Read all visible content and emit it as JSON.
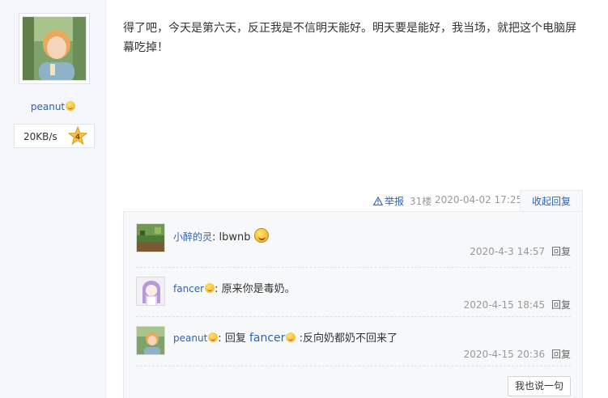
{
  "post": {
    "text": "得了吧，今天是第六天，反正我是不信明天能好。明天要是能好，我当场，就把这个电脑屏幕吃掉！",
    "report_label": "举报",
    "floor": "31楼",
    "date": "2020-04-02 17:25",
    "collapse_label": "收起回复"
  },
  "author": {
    "username": "peanut",
    "speed": "20KB/s",
    "level": "4"
  },
  "replies": [
    {
      "name": "小醉的灵",
      "separator": ":",
      "text": "lbwnb",
      "time": "2020-4-3 14:57",
      "reply_label": "回复"
    },
    {
      "name": "fancer",
      "separator": ":",
      "text": "原来你是毒奶。",
      "time": "2020-4-15 18:45",
      "reply_label": "回复"
    },
    {
      "name": "peanut",
      "separator": ":",
      "reply_word": "回复",
      "target": "fancer",
      "text": ":反向奶都奶不回来了",
      "time": "2020-4-15 20:36",
      "reply_label": "回复"
    }
  ],
  "say_button": "我也说一句",
  "colors": {
    "link": "#2d64b3",
    "muted": "#999999",
    "sidebar_bg": "#f4f6fb",
    "reply_bg": "#f7f8fa"
  },
  "icons": {
    "report": "warning-triangle-icon",
    "emoji": "smiley-emoji-icon",
    "level": "level-star-badge-icon"
  }
}
